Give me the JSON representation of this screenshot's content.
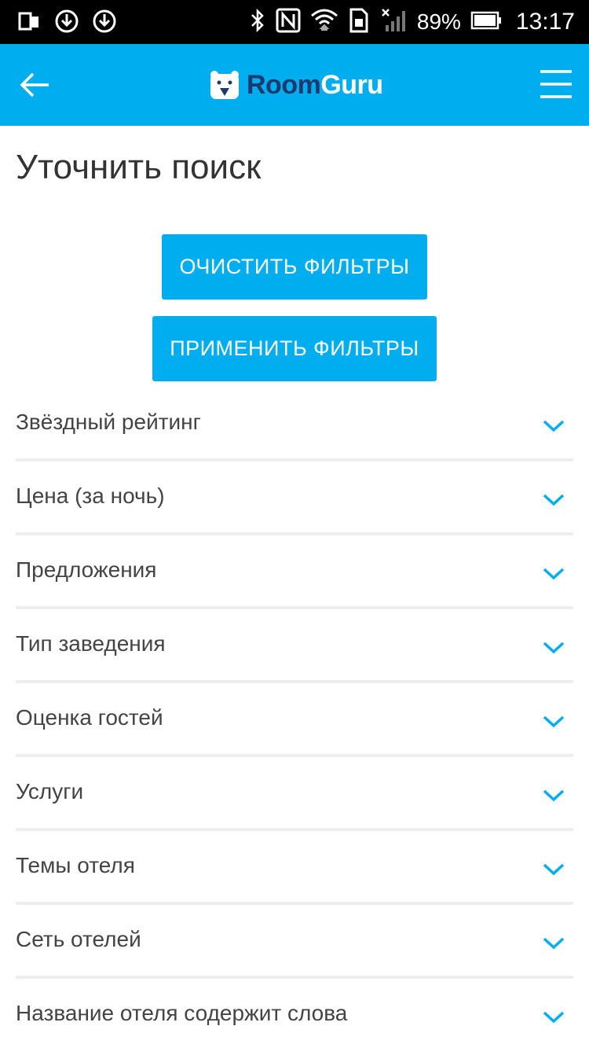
{
  "status_bar": {
    "battery_percent": "89%",
    "time": "13:17",
    "icons": [
      "screen-mirror-icon",
      "download-icon",
      "sync-icon",
      "bluetooth-icon",
      "nfc-icon",
      "wifi-icon",
      "sim-icon",
      "signal-icon",
      "battery-icon"
    ]
  },
  "header": {
    "logo_part1": "Room",
    "logo_part2": "Guru",
    "back_icon": "arrow-left-icon",
    "menu_icon": "hamburger-menu-icon",
    "background": "#00adee"
  },
  "page": {
    "title": "Уточнить поиск"
  },
  "buttons": {
    "clear": "ОЧИСТИТЬ ФИЛЬТРЫ",
    "apply": "ПРИМЕНИТЬ ФИЛЬТРЫ"
  },
  "filters": [
    {
      "label": "Звёздный рейтинг"
    },
    {
      "label": "Цена (за ночь)"
    },
    {
      "label": "Предложения"
    },
    {
      "label": "Тип заведения"
    },
    {
      "label": "Оценка гостей"
    },
    {
      "label": "Услуги"
    },
    {
      "label": "Темы отеля"
    },
    {
      "label": "Сеть отелей"
    },
    {
      "label": "Название отеля содержит слова"
    }
  ],
  "colors": {
    "accent": "#00adee",
    "logo_dark": "#1d3a6e"
  }
}
